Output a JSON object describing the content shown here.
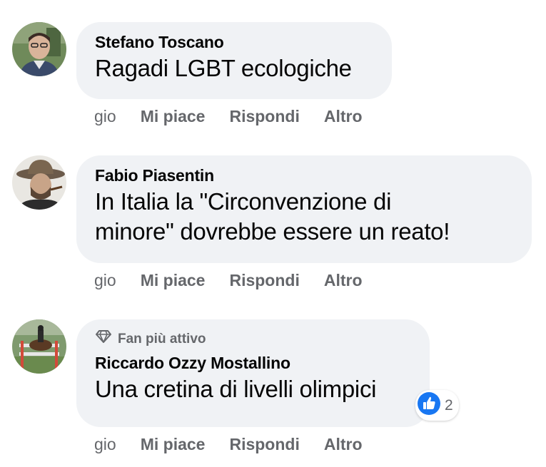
{
  "comments": [
    {
      "author": "Stefano Toscano",
      "text": "Ragadi LGBT ecologiche",
      "time": "gio",
      "like_label": "Mi piace",
      "reply_label": "Rispondi",
      "more_label": "Altro"
    },
    {
      "author": "Fabio Piasentin",
      "text_line1": "In Italia la \"Circonvenzione di",
      "text_line2": "minore\" dovrebbe essere un reato!",
      "time": "gio",
      "like_label": "Mi piace",
      "reply_label": "Rispondi",
      "more_label": "Altro"
    },
    {
      "badge": "Fan più attivo",
      "badge_icon": "diamond-icon",
      "author": "Riccardo Ozzy Mostallino",
      "text": "Una cretina di livelli olimpici",
      "reaction_icon": "like-icon",
      "reaction_count": "2",
      "time": "gio",
      "like_label": "Mi piace",
      "reply_label": "Rispondi",
      "more_label": "Altro"
    }
  ],
  "colors": {
    "bubble": "#f0f2f5",
    "secondary_text": "#65676b",
    "like_blue": "#1877f2"
  }
}
